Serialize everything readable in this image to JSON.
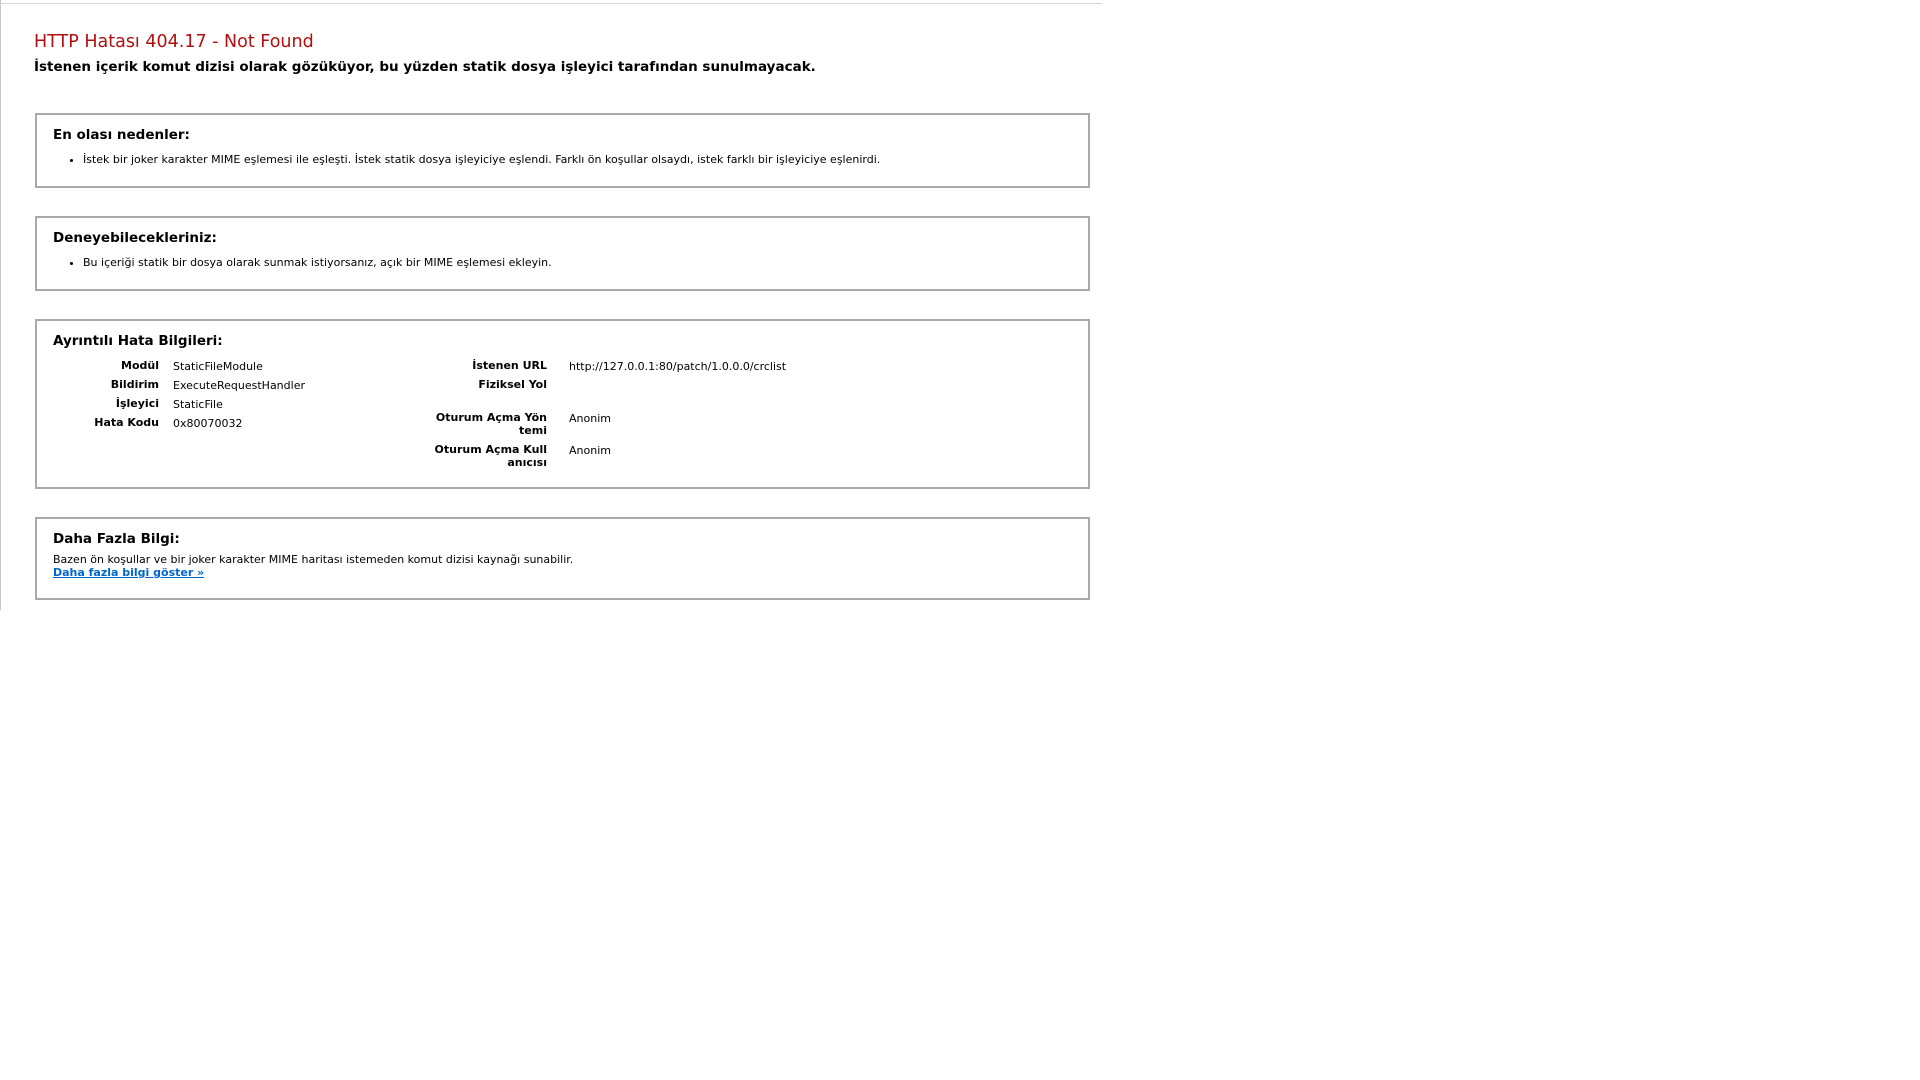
{
  "header": {
    "title": "HTTP Hatası 404.17 - Not Found",
    "subtitle": "İstenen içerik komut dizisi olarak gözüküyor, bu yüzden statik dosya işleyici tarafından sunulmayacak."
  },
  "causes": {
    "title": "En olası nedenler:",
    "items": [
      "İstek bir joker karakter MIME eşlemesi ile eşleşti. İstek statik dosya işleyiciye eşlendi. Farklı ön koşullar olsaydı, istek farklı bir işleyiciye eşlenirdi."
    ]
  },
  "try": {
    "title": "Deneyebilecekleriniz:",
    "items": [
      "Bu içeriği statik bir dosya olarak sunmak istiyorsanız, açık bir MIME eşlemesi ekleyin."
    ]
  },
  "details": {
    "title": "Ayrıntılı Hata Bilgileri:",
    "left": [
      {
        "label": "Modül",
        "value": "StaticFileModule"
      },
      {
        "label": "Bildirim",
        "value": "ExecuteRequestHandler"
      },
      {
        "label": "İşleyici",
        "value": "StaticFile"
      },
      {
        "label": "Hata Kodu",
        "value": "0x80070032"
      }
    ],
    "right": [
      {
        "label_line1": "İstenen URL",
        "label_line2": "",
        "value": "http://127.0.0.1:80/patch/1.0.0.0/crclist"
      },
      {
        "label_line1": "Fiziksel Yol",
        "label_line2": "",
        "value": ""
      },
      {
        "label_line1": "Oturum Açma Yön",
        "label_line2": "temi",
        "value": "Anonim"
      },
      {
        "label_line1": "Oturum Açma Kull",
        "label_line2": "anıcısı",
        "value": "Anonim"
      }
    ]
  },
  "more": {
    "title": "Daha Fazla Bilgi:",
    "text": "Bazen ön koşullar ve bir joker karakter MIME haritası istemeden komut dizisi kaynağı sunabilir.",
    "link": "Daha fazla bilgi göster »"
  },
  "colors": {
    "title_red": "#b01010",
    "link_blue": "#0066cc",
    "box_border": "#a9a9a9"
  }
}
